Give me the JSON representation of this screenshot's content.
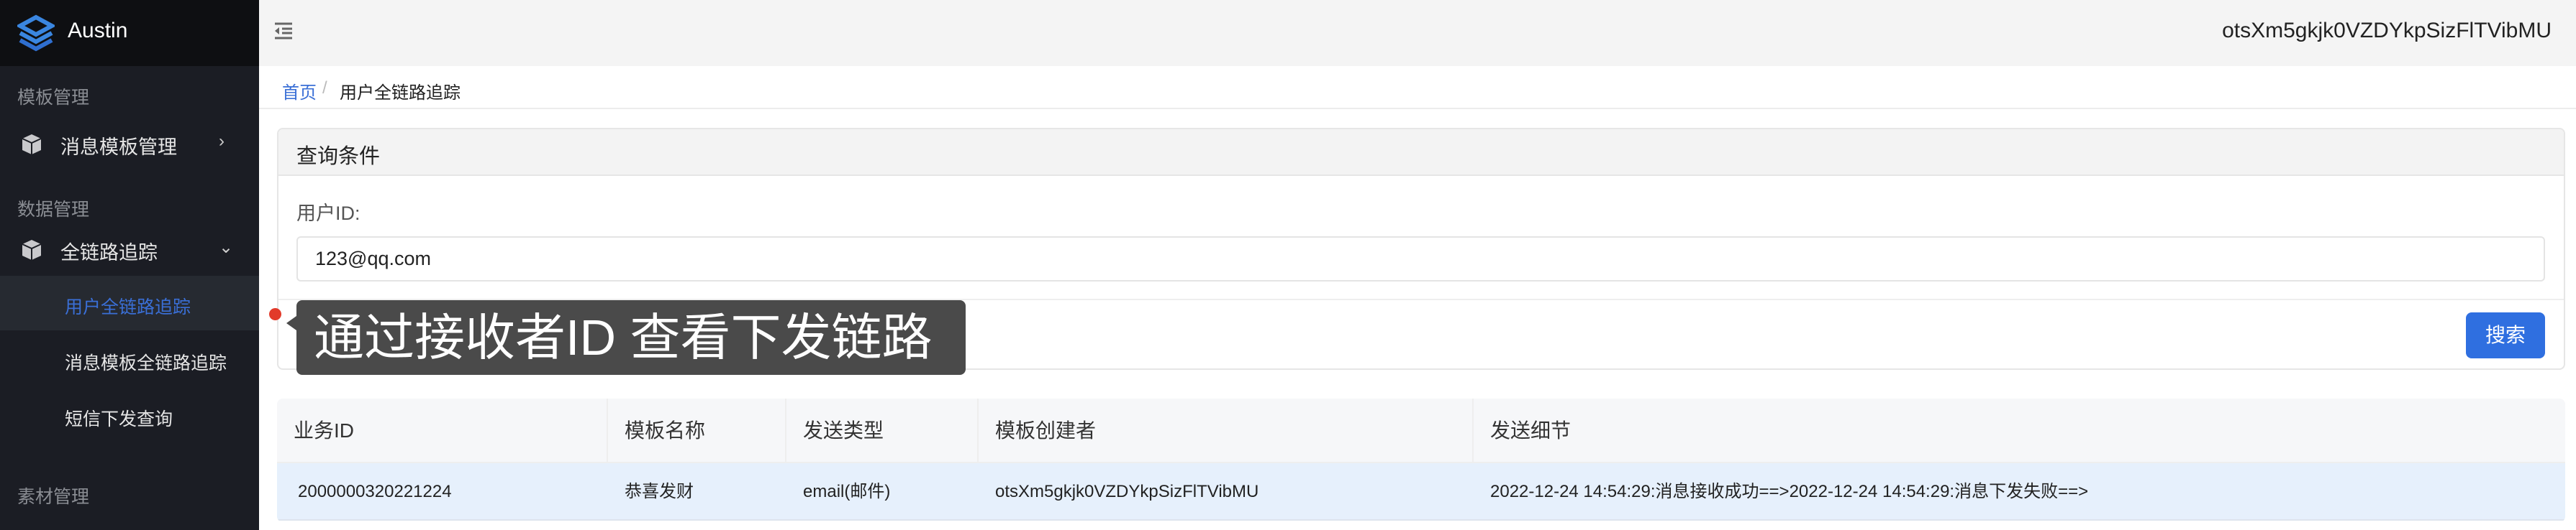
{
  "app": {
    "name": "Austin",
    "brand_color": "#3a86e0"
  },
  "header": {
    "user": "otsXm5gkjk0VZDYkpSizFlTVibMU"
  },
  "sidebar": {
    "groups": [
      {
        "label": "模板管理"
      },
      {
        "label": "数据管理"
      },
      {
        "label": "素材管理"
      }
    ],
    "items": [
      {
        "label": "消息模板管理",
        "icon": "cube-icon",
        "state": "collapsed"
      },
      {
        "label": "全链路追踪",
        "icon": "cube-icon",
        "state": "expanded"
      }
    ],
    "subitems": [
      {
        "label": "用户全链路追踪",
        "active": true
      },
      {
        "label": "消息模板全链路追踪"
      },
      {
        "label": "短信下发查询"
      }
    ]
  },
  "breadcrumb": {
    "home": "首页",
    "separator": "/",
    "current": "用户全链路追踪"
  },
  "query": {
    "title": "查询条件",
    "field_label": "用户ID:",
    "field_value": "123@qq.com",
    "search_label": "搜索"
  },
  "tooltip": {
    "text": "通过接收者ID 查看下发链路"
  },
  "table": {
    "columns": [
      "业务ID",
      "模板名称",
      "发送类型",
      "模板创建者",
      "发送细节"
    ],
    "rows": [
      [
        "2000000320221224",
        "恭喜发财",
        "email(邮件)",
        "otsXm5gkjk0VZDYkpSizFlTVibMU",
        "2022-12-24 14:54:29:消息接收成功==>2022-12-24 14:54:29:消息下发失败==>"
      ]
    ]
  },
  "colors": {
    "accent": "#2f6fe0",
    "sidebar_bg": "#1b1d24",
    "active_text": "#3a6fd6",
    "row_highlight": "#e6f0fc"
  }
}
